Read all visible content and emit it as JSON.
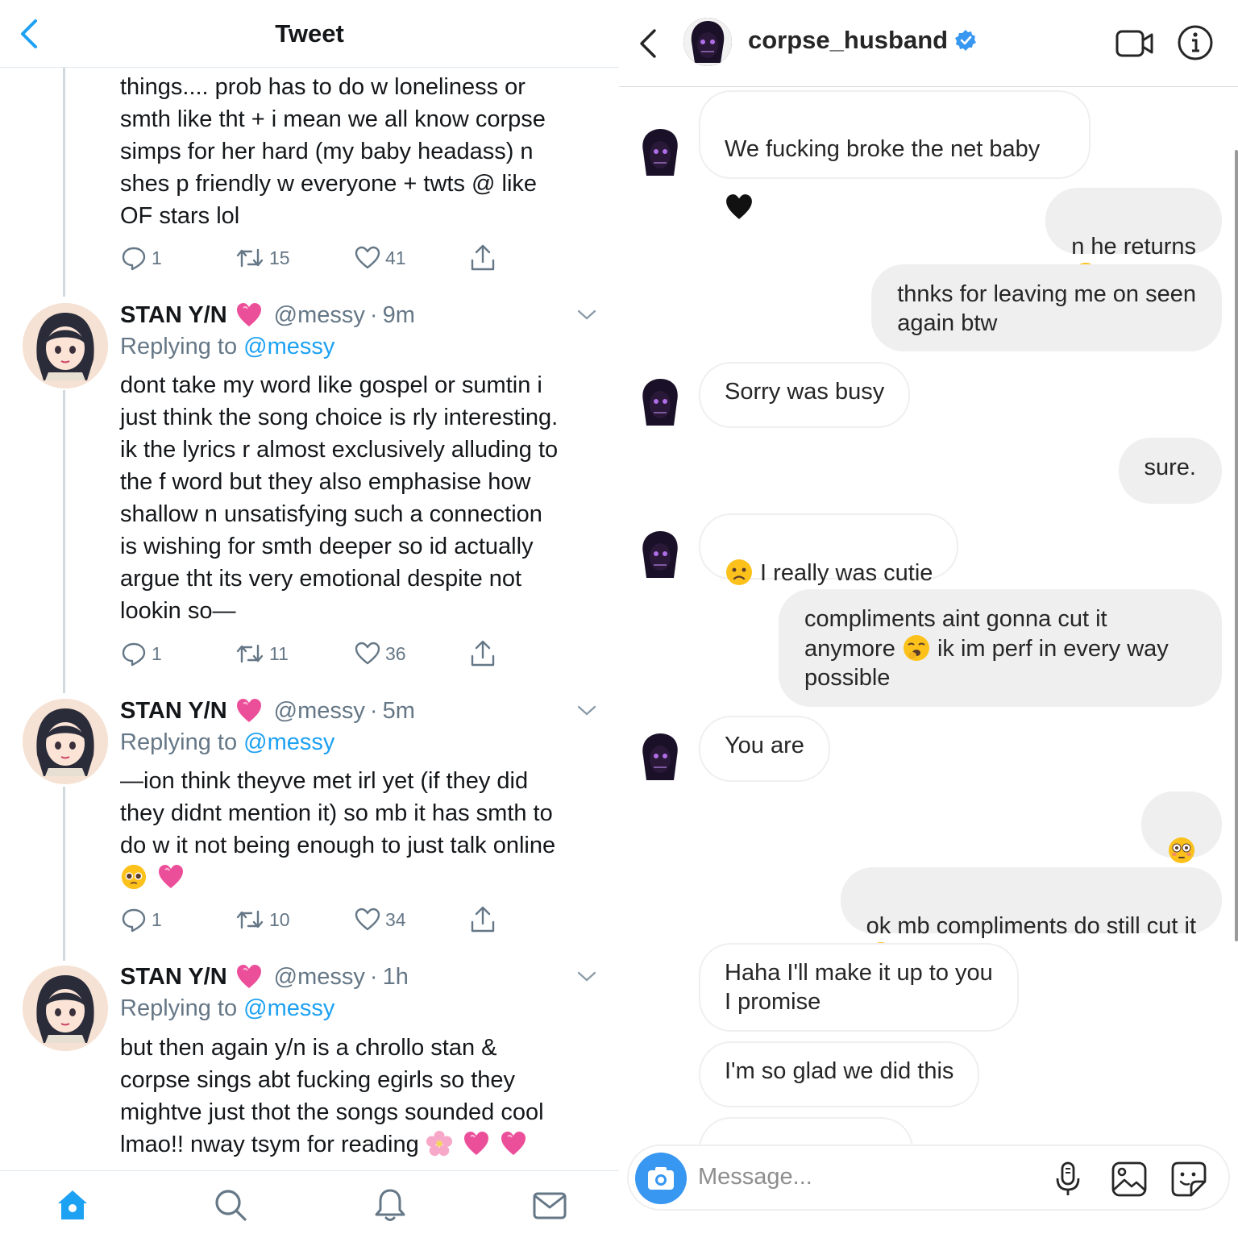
{
  "twitter": {
    "header": {
      "title": "Tweet"
    },
    "tweet0": {
      "text": "things.... prob has to do w loneliness or\nsmth like tht + i mean we all know corpse\nsimps for her hard (my baby headass) n\nshes p friendly w everyone + twts @ like\nOF stars lol",
      "replies": "1",
      "retweets": "15",
      "likes": "41"
    },
    "tweets": [
      {
        "name": "STAN Y/N",
        "handle": "@messy",
        "time": "9m",
        "replying_prefix": "Replying to ",
        "replying_to": "@messy",
        "text": "dont take my word like gospel or sumtin i\njust think the song choice is rly interesting.\nik the lyrics r almost exclusively alluding to\nthe f word but they also emphasise how\nshallow n unsatisfying such a connection\nis wishing for smth deeper so id actually\nargue tht its very emotional despite not\nlookin so—",
        "replies": "1",
        "retweets": "11",
        "likes": "36"
      },
      {
        "name": "STAN Y/N",
        "handle": "@messy",
        "time": "5m",
        "replying_prefix": "Replying to ",
        "replying_to": "@messy",
        "text": "—ion think theyve met irl yet (if they did\nthey didnt mention it) so mb it has smth to\ndo w it not being enough to just talk online",
        "emoji_line": [
          "pleading-face",
          "pink-heart"
        ],
        "replies": "1",
        "retweets": "10",
        "likes": "34"
      },
      {
        "name": "STAN Y/N",
        "handle": "@messy",
        "time": "1h",
        "replying_prefix": "Replying to ",
        "replying_to": "@messy",
        "text_lines": [
          "but then again y/n is a chrollo stan &",
          "corpse sings abt fucking egirls so they",
          "mightve just thot the songs sounded cool"
        ],
        "last_line": "lmao!! nway tsym for reading",
        "last_line_emoji": [
          "cherry-blossom",
          "pink-heart",
          "pink-heart"
        ]
      }
    ],
    "dot": "·",
    "nav": [
      "home-icon",
      "search-icon",
      "bell-icon",
      "mail-icon"
    ],
    "colors": {
      "accent": "#1da1f2",
      "muted": "#657786"
    }
  },
  "instagram": {
    "header": {
      "username": "corpse_husband",
      "verified": true
    },
    "messages": [
      {
        "side": "in",
        "text": "We fucking broke the net baby",
        "emoji_after": "black-heart"
      },
      {
        "side": "out",
        "text": "n he returns ",
        "emoji_after": "unamused-face"
      },
      {
        "side": "out",
        "text": "thnks for leaving me on seen\nagain btw"
      },
      {
        "side": "in",
        "text": "Sorry was busy"
      },
      {
        "side": "out",
        "text": "sure."
      },
      {
        "side": "in",
        "text": " I really was cutie",
        "emoji_before": "slightly-frowning-face"
      },
      {
        "side": "out",
        "line1": "compliments aint gonna cut it",
        "line2a": "anymore ",
        "line2b": " ik im perf in every way",
        "line3": "possible",
        "emoji_mid": "yawning-face"
      },
      {
        "side": "in",
        "text": "You are"
      },
      {
        "side": "out",
        "text": "",
        "emoji_only": "flushed-face"
      },
      {
        "side": "out",
        "text": "ok mb compliments do still cut it ",
        "emoji_after": "woozy-face"
      },
      {
        "side": "in",
        "text": "Haha I'll make it up to you\nI promise"
      },
      {
        "side": "in",
        "text": "I'm so glad we did this"
      }
    ],
    "composer": {
      "placeholder": "Message..."
    },
    "tools": [
      "microphone-icon",
      "gallery-icon",
      "sticker-icon"
    ],
    "colors": {
      "bubble_out": "#efefef",
      "verified": "#3897f0",
      "camera": "#3897f0"
    }
  }
}
